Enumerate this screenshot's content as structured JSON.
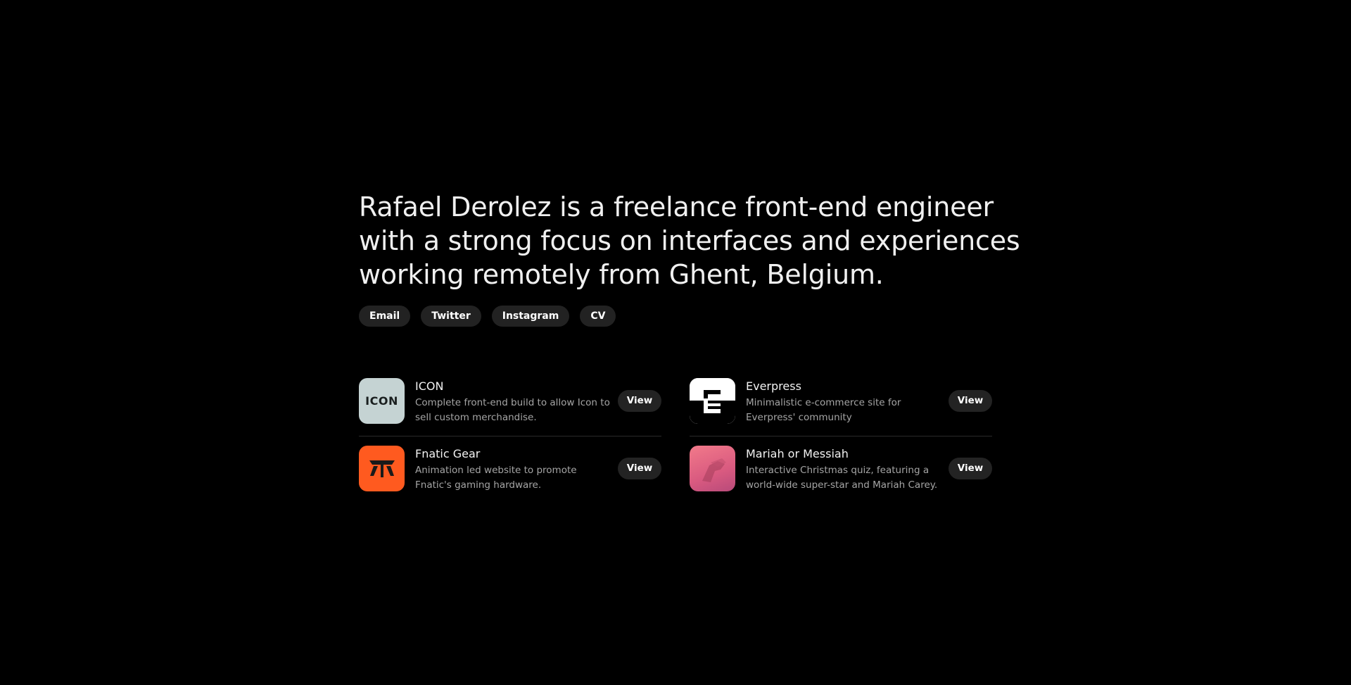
{
  "intro": {
    "line1": "Rafael Derolez is a freelance front-end engineer",
    "line2": "with a strong focus on interfaces and experiences",
    "line3": "working remotely from Ghent, Belgium."
  },
  "links": [
    "Email",
    "Twitter",
    "Instagram",
    "CV"
  ],
  "projects": [
    {
      "name": "ICON",
      "desc": "Complete front-end build to allow Icon to sell custom merchandise.",
      "view": "View",
      "logo_text": "ICON",
      "icon": "icon-logo"
    },
    {
      "name": "Everpress",
      "desc": "Minimalistic e-commerce site for Everpress' community",
      "view": "View",
      "icon": "everpress-logo"
    },
    {
      "name": "Fnatic Gear",
      "desc": "Animation led website to promote Fnatic's gaming hardware.",
      "view": "View",
      "icon": "fnatic-logo"
    },
    {
      "name": "Mariah or Messiah",
      "desc": "Interactive Christmas quiz, featuring a world-wide super-star and Mariah Carey.",
      "view": "View",
      "icon": "mariah-thumbnail"
    }
  ],
  "colors": {
    "background": "#000000",
    "pill": "#222222",
    "icon_thumb": "#c5d3d3",
    "fnatic": "#ff5a1f",
    "mariah": "#e46e86"
  }
}
